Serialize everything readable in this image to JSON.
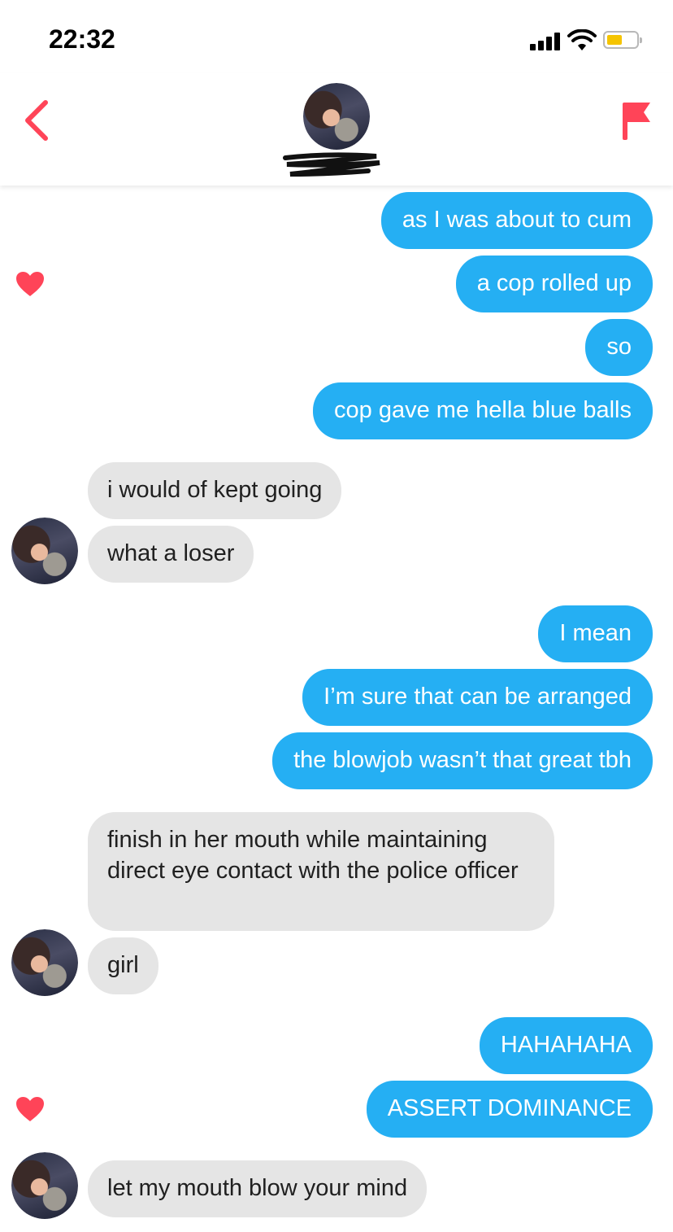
{
  "status": {
    "time": "22:32"
  },
  "colors": {
    "accent": "#ff4458",
    "sent_bubble": "#25aff3",
    "received_bubble": "#e5e5e5"
  },
  "header": {
    "back_icon": "chevron-left-icon",
    "flag_icon": "flag-icon"
  },
  "messages": {
    "sent1": "as I was about to cum",
    "sent2": "a cop rolled up",
    "sent3": "so",
    "sent4": "cop gave me hella blue balls",
    "recv1": "i would of kept going",
    "recv2": "what a loser",
    "sent5": "I mean",
    "sent6": "I’m sure that can be arranged",
    "sent7": "the blowjob wasn’t that great tbh",
    "recv3": "finish in her mouth while maintaining direct eye contact with the police officer",
    "recv4": "girl",
    "sent8": "HAHAHAHA",
    "sent9": "ASSERT DOMINANCE",
    "recv5": "let my mouth blow your mind"
  }
}
